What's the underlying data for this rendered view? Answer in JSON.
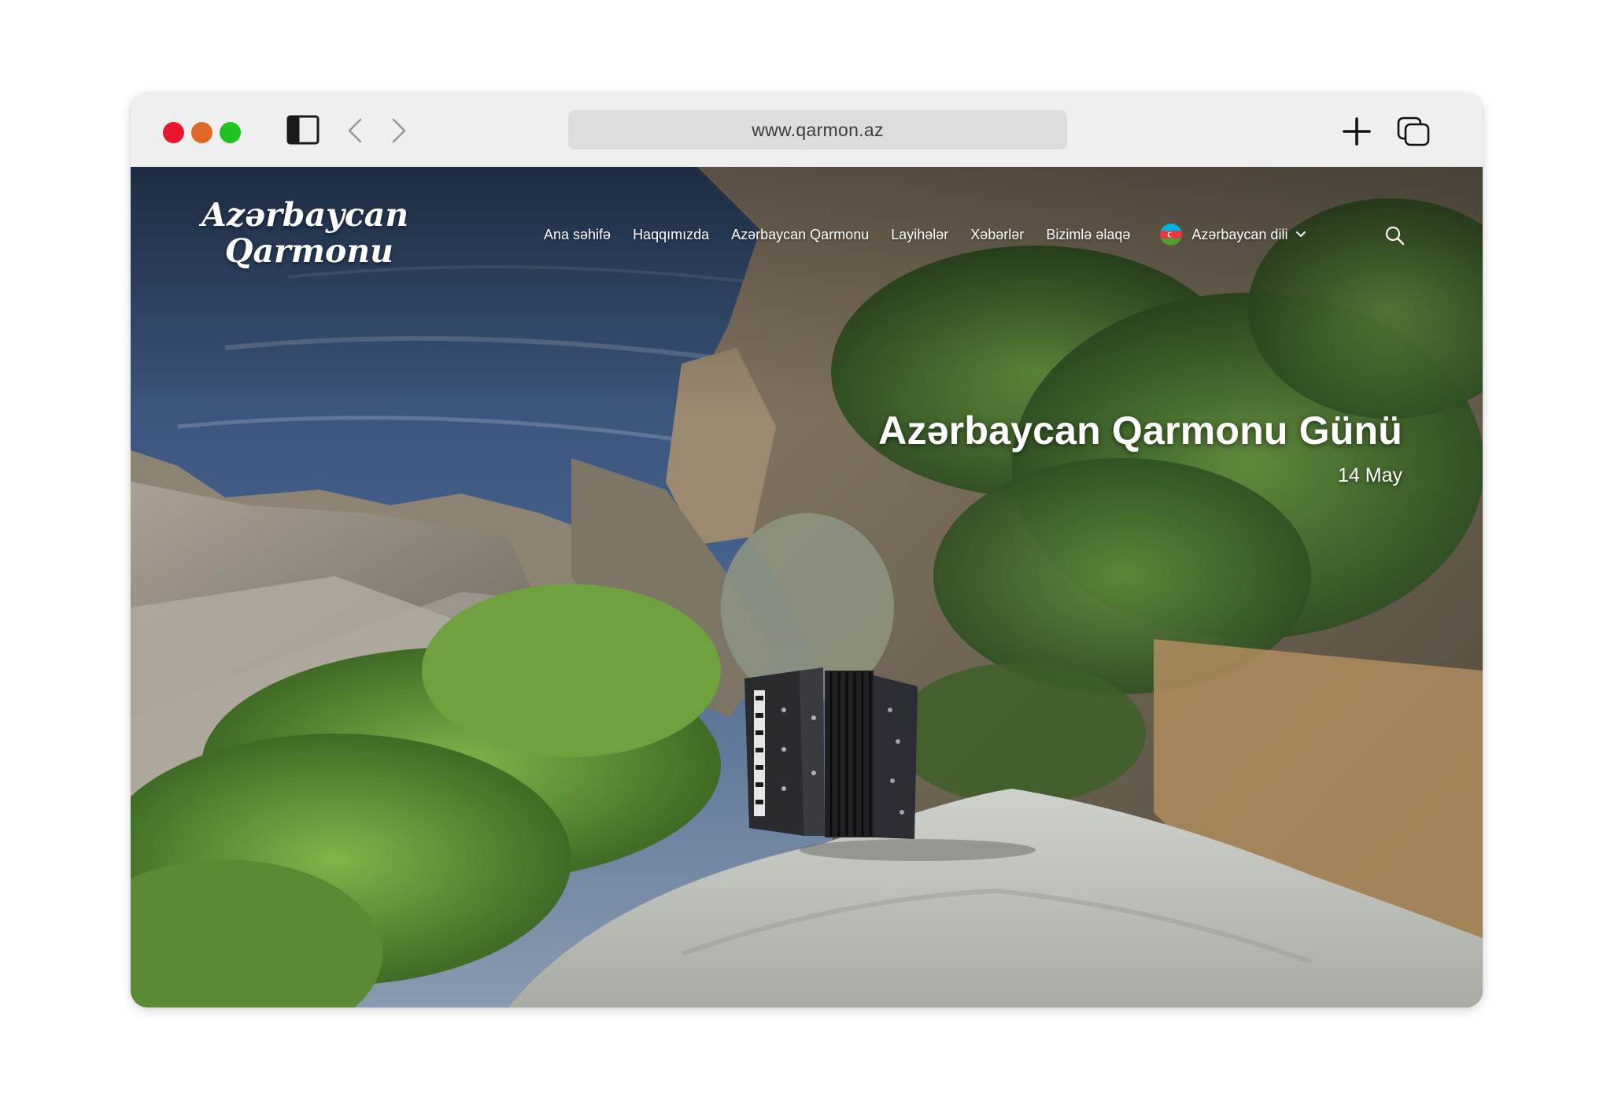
{
  "browser": {
    "url": "www.qarmon.az",
    "icons": [
      "close-dot",
      "minimize-dot",
      "zoom-dot",
      "sidebar-icon",
      "back-icon",
      "forward-icon",
      "plus-icon",
      "tabs-icon"
    ]
  },
  "site": {
    "logo_line1": "Azərbaycan",
    "logo_line2": "Qarmonu",
    "nav": [
      "Ana səhifə",
      "Haqqımızda",
      "Azərbaycan Qarmonu",
      "Layihələr",
      "Xəbərlər",
      "Bizimlə əlaqə"
    ],
    "language": "Azərbaycan dili",
    "icons": [
      "azerbaijan-flag-icon",
      "chevron-down-icon",
      "search-icon"
    ]
  },
  "hero": {
    "title": "Azərbaycan Qarmonu Günü",
    "date": "14 May"
  },
  "colors": {
    "close": "#e9162d",
    "minimize": "#e0692a",
    "zoom": "#1fc31f",
    "toolbar_bg": "#efefef",
    "address_bg": "#dcdcdc"
  }
}
